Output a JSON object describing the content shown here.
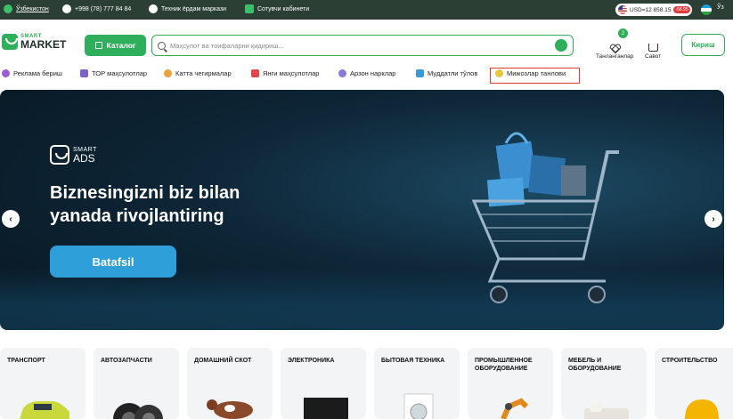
{
  "topbar": {
    "region": "Ўзбекистон",
    "phone": "+998 (78) 777 84 84",
    "support": "Техник ёрдам маркази",
    "seller": "Сотувчи кабинети",
    "currency": "USD=12 858.15",
    "currency_change": "-58.95",
    "language": "Ўз"
  },
  "header": {
    "logo_small": "SMART",
    "logo_big": "MARKET",
    "catalog_label": "Каталог",
    "search_placeholder": "Маҳсулот ва тоифаларни қидириш...",
    "favorites_count": "2",
    "favorites_label": "Танланганлар",
    "cart_label": "Савот",
    "login_label": "Кириш"
  },
  "nav": {
    "items": [
      {
        "label": "Реклама бериш"
      },
      {
        "label": "ТОР маҳсулотлар"
      },
      {
        "label": "Катта чегирмалар"
      },
      {
        "label": "Янги маҳсулотлар"
      },
      {
        "label": "Арзон нарклар"
      },
      {
        "label": "Муддатли тўлов"
      },
      {
        "label": "Мижозлар танлови"
      }
    ]
  },
  "banner": {
    "logo_small": "SMART",
    "logo_big": "ADS",
    "headline_line1": "Biznesingizni biz bilan",
    "headline_line2": "yanada rivojlantiring",
    "cta_label": "Batafsil",
    "prev_icon": "‹",
    "next_icon": "›"
  },
  "categories": [
    {
      "label": "ТРАНСПОРТ"
    },
    {
      "label": "АВТОЗАПЧАСТИ"
    },
    {
      "label": "ДОМАШНИЙ СКОТ"
    },
    {
      "label": "ЭЛЕКТРОНИКА"
    },
    {
      "label": "БЫТОВАЯ ТЕХНИКА"
    },
    {
      "label": "ПРОМЫШЛЕННОЕ ОБОРУДОВАНИЕ"
    },
    {
      "label": "МЕБЕЛЬ И ОБОРУДОВАНИЕ"
    },
    {
      "label": "СТРОИТЕЛЬСТВО"
    }
  ],
  "colors": {
    "brand_green": "#2fae5b",
    "topbar_bg": "#2b3f35",
    "banner_button": "#2e9fd8",
    "highlight_border": "#e53935"
  }
}
